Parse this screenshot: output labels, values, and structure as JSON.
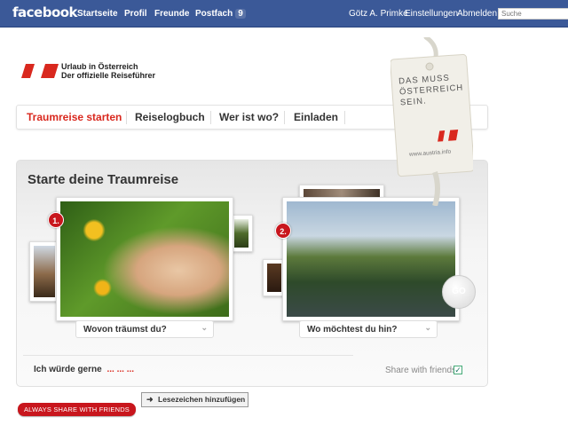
{
  "topbar": {
    "logo": "facebook",
    "startseite": "Startseite",
    "profil": "Profil",
    "freunde": "Freunde",
    "postfach": "Postfach",
    "postfach_count": "9",
    "user": "Götz A. Primke",
    "einstellungen": "Einstellungen",
    "abmelden": "Abmelden",
    "search_placeholder": "Suche"
  },
  "brand": {
    "line1": "Urlaub in Österreich",
    "line2": "Der offizielle Reiseführer"
  },
  "tabs": [
    "Traumreise starten",
    "Reiselogbuch",
    "Wer ist wo?",
    "Einladen"
  ],
  "tag": {
    "line1": "DAS MUSS",
    "line2": "ÖSTERREICH",
    "line3": "SEIN.",
    "url": "www.austria.info"
  },
  "panel": {
    "title": "Starte deine Traumreise",
    "step1": "1.",
    "step2": "2.",
    "dropdown1": "Wovon träumst du?",
    "dropdown2": "Wo möchtest du hin?",
    "go": "GO",
    "wish_label": "Ich würde gerne",
    "wish_dots": "... ... ...",
    "share_label": "Share with friends",
    "share_checked": true
  },
  "footer": {
    "always_share": "ALWAYS SHARE WITH FRIENDS",
    "bookmark": "Lesezeichen hinzufügen"
  },
  "colors": {
    "facebook_blue": "#3b5998",
    "austria_red": "#d9281e"
  }
}
